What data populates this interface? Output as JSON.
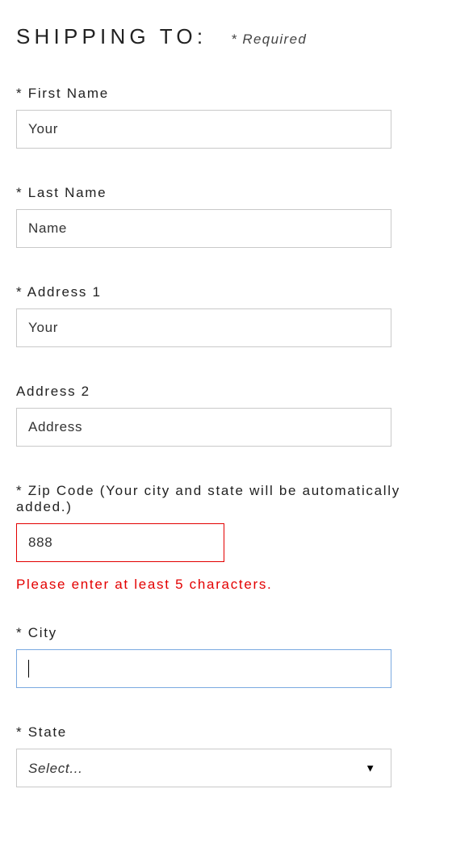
{
  "heading": "SHIPPING TO:",
  "required_note": "* Required",
  "fields": {
    "first_name": {
      "label": "* First Name",
      "value": "Your"
    },
    "last_name": {
      "label": "* Last Name",
      "value": "Name"
    },
    "address1": {
      "label": "* Address 1",
      "value": "Your"
    },
    "address2": {
      "label": "Address 2",
      "value": "Address"
    },
    "zip": {
      "label": "* Zip Code (Your city and state will be automatically added.)",
      "value": "888",
      "error": "Please enter at least 5 characters."
    },
    "city": {
      "label": "* City",
      "value": ""
    },
    "state": {
      "label": "* State",
      "selected": "Select..."
    }
  }
}
